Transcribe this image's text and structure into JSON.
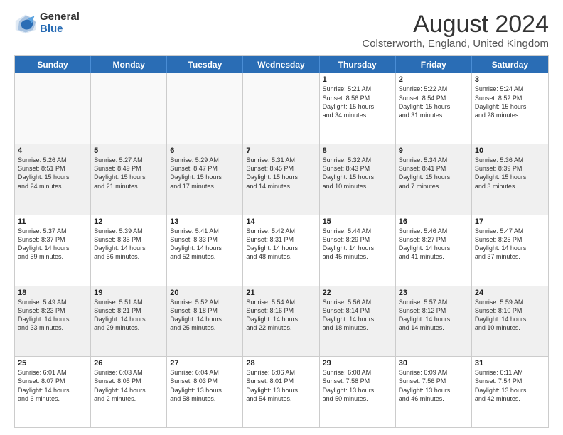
{
  "logo": {
    "general": "General",
    "blue": "Blue"
  },
  "title": "August 2024",
  "subtitle": "Colsterworth, England, United Kingdom",
  "header_days": [
    "Sunday",
    "Monday",
    "Tuesday",
    "Wednesday",
    "Thursday",
    "Friday",
    "Saturday"
  ],
  "rows": [
    [
      {
        "day": "",
        "text": "",
        "empty": true
      },
      {
        "day": "",
        "text": "",
        "empty": true
      },
      {
        "day": "",
        "text": "",
        "empty": true
      },
      {
        "day": "",
        "text": "",
        "empty": true
      },
      {
        "day": "1",
        "text": "Sunrise: 5:21 AM\nSunset: 8:56 PM\nDaylight: 15 hours\nand 34 minutes."
      },
      {
        "day": "2",
        "text": "Sunrise: 5:22 AM\nSunset: 8:54 PM\nDaylight: 15 hours\nand 31 minutes."
      },
      {
        "day": "3",
        "text": "Sunrise: 5:24 AM\nSunset: 8:52 PM\nDaylight: 15 hours\nand 28 minutes."
      }
    ],
    [
      {
        "day": "4",
        "text": "Sunrise: 5:26 AM\nSunset: 8:51 PM\nDaylight: 15 hours\nand 24 minutes."
      },
      {
        "day": "5",
        "text": "Sunrise: 5:27 AM\nSunset: 8:49 PM\nDaylight: 15 hours\nand 21 minutes."
      },
      {
        "day": "6",
        "text": "Sunrise: 5:29 AM\nSunset: 8:47 PM\nDaylight: 15 hours\nand 17 minutes."
      },
      {
        "day": "7",
        "text": "Sunrise: 5:31 AM\nSunset: 8:45 PM\nDaylight: 15 hours\nand 14 minutes."
      },
      {
        "day": "8",
        "text": "Sunrise: 5:32 AM\nSunset: 8:43 PM\nDaylight: 15 hours\nand 10 minutes."
      },
      {
        "day": "9",
        "text": "Sunrise: 5:34 AM\nSunset: 8:41 PM\nDaylight: 15 hours\nand 7 minutes."
      },
      {
        "day": "10",
        "text": "Sunrise: 5:36 AM\nSunset: 8:39 PM\nDaylight: 15 hours\nand 3 minutes."
      }
    ],
    [
      {
        "day": "11",
        "text": "Sunrise: 5:37 AM\nSunset: 8:37 PM\nDaylight: 14 hours\nand 59 minutes."
      },
      {
        "day": "12",
        "text": "Sunrise: 5:39 AM\nSunset: 8:35 PM\nDaylight: 14 hours\nand 56 minutes."
      },
      {
        "day": "13",
        "text": "Sunrise: 5:41 AM\nSunset: 8:33 PM\nDaylight: 14 hours\nand 52 minutes."
      },
      {
        "day": "14",
        "text": "Sunrise: 5:42 AM\nSunset: 8:31 PM\nDaylight: 14 hours\nand 48 minutes."
      },
      {
        "day": "15",
        "text": "Sunrise: 5:44 AM\nSunset: 8:29 PM\nDaylight: 14 hours\nand 45 minutes."
      },
      {
        "day": "16",
        "text": "Sunrise: 5:46 AM\nSunset: 8:27 PM\nDaylight: 14 hours\nand 41 minutes."
      },
      {
        "day": "17",
        "text": "Sunrise: 5:47 AM\nSunset: 8:25 PM\nDaylight: 14 hours\nand 37 minutes."
      }
    ],
    [
      {
        "day": "18",
        "text": "Sunrise: 5:49 AM\nSunset: 8:23 PM\nDaylight: 14 hours\nand 33 minutes."
      },
      {
        "day": "19",
        "text": "Sunrise: 5:51 AM\nSunset: 8:21 PM\nDaylight: 14 hours\nand 29 minutes."
      },
      {
        "day": "20",
        "text": "Sunrise: 5:52 AM\nSunset: 8:18 PM\nDaylight: 14 hours\nand 25 minutes."
      },
      {
        "day": "21",
        "text": "Sunrise: 5:54 AM\nSunset: 8:16 PM\nDaylight: 14 hours\nand 22 minutes."
      },
      {
        "day": "22",
        "text": "Sunrise: 5:56 AM\nSunset: 8:14 PM\nDaylight: 14 hours\nand 18 minutes."
      },
      {
        "day": "23",
        "text": "Sunrise: 5:57 AM\nSunset: 8:12 PM\nDaylight: 14 hours\nand 14 minutes."
      },
      {
        "day": "24",
        "text": "Sunrise: 5:59 AM\nSunset: 8:10 PM\nDaylight: 14 hours\nand 10 minutes."
      }
    ],
    [
      {
        "day": "25",
        "text": "Sunrise: 6:01 AM\nSunset: 8:07 PM\nDaylight: 14 hours\nand 6 minutes."
      },
      {
        "day": "26",
        "text": "Sunrise: 6:03 AM\nSunset: 8:05 PM\nDaylight: 14 hours\nand 2 minutes."
      },
      {
        "day": "27",
        "text": "Sunrise: 6:04 AM\nSunset: 8:03 PM\nDaylight: 13 hours\nand 58 minutes."
      },
      {
        "day": "28",
        "text": "Sunrise: 6:06 AM\nSunset: 8:01 PM\nDaylight: 13 hours\nand 54 minutes."
      },
      {
        "day": "29",
        "text": "Sunrise: 6:08 AM\nSunset: 7:58 PM\nDaylight: 13 hours\nand 50 minutes."
      },
      {
        "day": "30",
        "text": "Sunrise: 6:09 AM\nSunset: 7:56 PM\nDaylight: 13 hours\nand 46 minutes."
      },
      {
        "day": "31",
        "text": "Sunrise: 6:11 AM\nSunset: 7:54 PM\nDaylight: 13 hours\nand 42 minutes."
      }
    ]
  ]
}
